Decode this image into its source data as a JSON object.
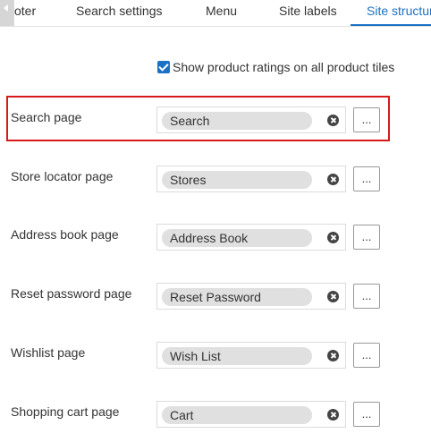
{
  "tabs": [
    {
      "label": "oter",
      "active": false
    },
    {
      "label": "Search settings",
      "active": false
    },
    {
      "label": "Menu",
      "active": false
    },
    {
      "label": "Site labels",
      "active": false
    },
    {
      "label": "Site structure",
      "active": true
    }
  ],
  "options": {
    "show_ratings_label": "Show product ratings on all product tiles",
    "show_ratings_checked": true
  },
  "fields": [
    {
      "label": "Search page",
      "value": "Search",
      "more_label": "..."
    },
    {
      "label": "Store locator page",
      "value": "Stores",
      "more_label": "..."
    },
    {
      "label": "Address book page",
      "value": "Address Book",
      "more_label": "..."
    },
    {
      "label": "Reset password page",
      "value": "Reset Password",
      "more_label": "..."
    },
    {
      "label": "Wishlist page",
      "value": "Wish List",
      "more_label": "..."
    },
    {
      "label": "Shopping cart page",
      "value": "Cart",
      "more_label": "..."
    }
  ],
  "colors": {
    "accent": "#1b72c4",
    "highlight": "#d7191c",
    "pill": "#e0e0e0"
  }
}
